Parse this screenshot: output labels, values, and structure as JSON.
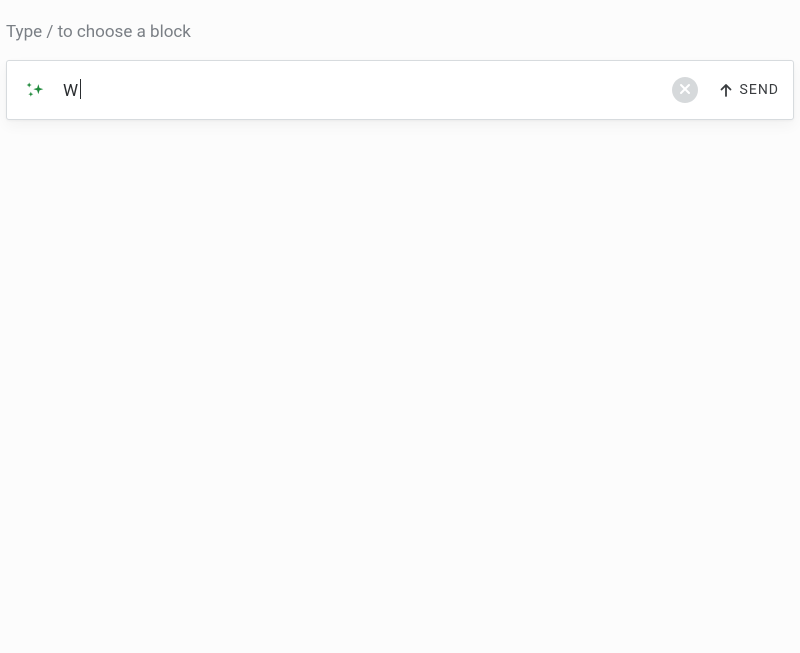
{
  "hint": {
    "text": "Type / to choose a block"
  },
  "compose": {
    "value": "W",
    "send_label": "SEND"
  },
  "icons": {
    "sparkle": "ai-sparkle",
    "clear": "close",
    "send_arrow": "arrow-up"
  },
  "colors": {
    "accent_green": "#1f8a3b",
    "clear_bg": "#d6d9db",
    "text": "#2a2d30",
    "hint": "#7a7f85"
  }
}
